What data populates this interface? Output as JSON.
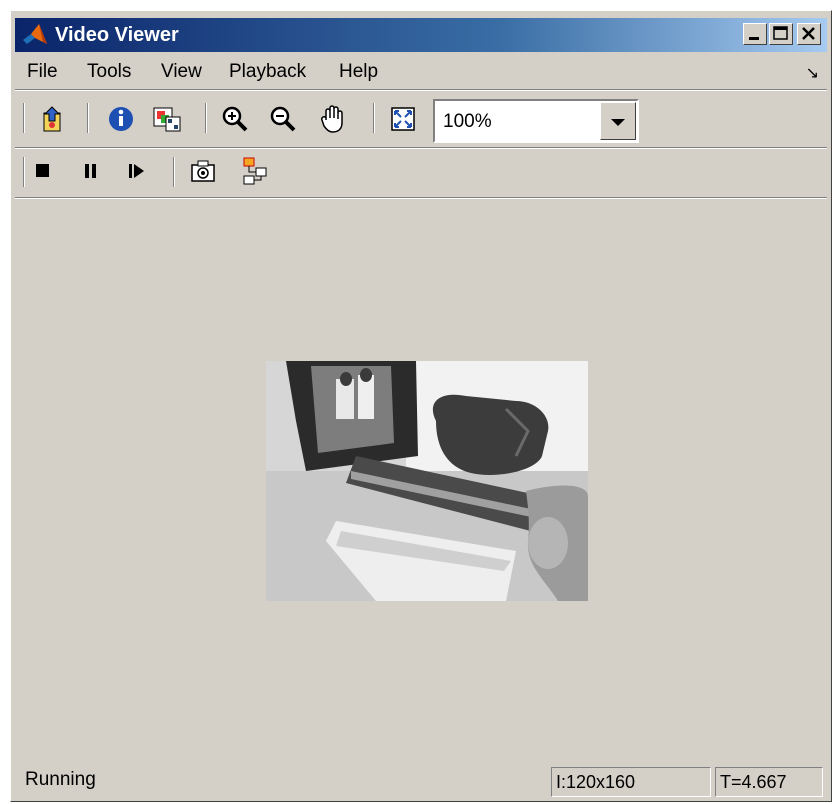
{
  "window": {
    "title": "Video Viewer"
  },
  "menu": {
    "items": [
      "File",
      "Tools",
      "View",
      "Playback",
      "Help"
    ]
  },
  "toolbar": {
    "zoom_value": "100%"
  },
  "status": {
    "state": "Running",
    "image_size": "I:120x160",
    "time": "T=4.667"
  }
}
